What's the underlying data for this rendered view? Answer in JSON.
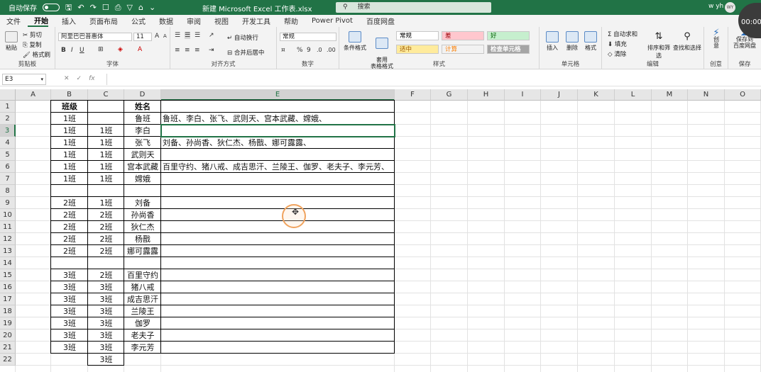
{
  "titlebar": {
    "autosave_label": "自动保存",
    "autosave_state": "关",
    "title": "新建 Microsoft Excel 工作表.xlsx",
    "search_placeholder": "搜索",
    "user_name": "w yh",
    "user_initials": "WY",
    "timer": "00:00"
  },
  "tabs": [
    "文件",
    "开始",
    "插入",
    "页面布局",
    "公式",
    "数据",
    "审阅",
    "视图",
    "开发工具",
    "帮助",
    "Power Pivot",
    "百度网盘"
  ],
  "active_tab": "开始",
  "ribbon": {
    "clipboard": {
      "label": "剪贴板",
      "paste": "粘贴",
      "cut": "剪切",
      "copy": "复制",
      "format_painter": "格式刷"
    },
    "font": {
      "label": "字体",
      "font_name": "阿里巴巴普惠体",
      "font_size": "11",
      "bold": "B",
      "italic": "I",
      "underline": "U"
    },
    "alignment": {
      "label": "对齐方式",
      "wrap": "自动换行",
      "merge": "合并后居中"
    },
    "number": {
      "label": "数字",
      "format": "常规",
      "percent": "%",
      "comma": "9"
    },
    "styles": {
      "label": "样式",
      "conditional": "条件格式",
      "table": "套用\n表格格式",
      "cells": [
        {
          "name": "常规",
          "bg": "#ffffff",
          "fg": "#000000"
        },
        {
          "name": "差",
          "bg": "#ffc7ce",
          "fg": "#9c0006"
        },
        {
          "name": "好",
          "bg": "#c6efce",
          "fg": "#006100"
        },
        {
          "name": "适中",
          "bg": "#ffeb9c",
          "fg": "#9c5700"
        },
        {
          "name": "计算",
          "bg": "#f2f2f2",
          "fg": "#fa7d00"
        },
        {
          "name": "检查单元格",
          "bg": "#a5a5a5",
          "fg": "#ffffff"
        }
      ]
    },
    "cells_group": {
      "label": "单元格",
      "insert": "插入",
      "delete": "删除",
      "format": "格式"
    },
    "editing": {
      "label": "编辑",
      "autosum": "自动求和",
      "fill": "填充",
      "clear": "清除",
      "sort": "排序和筛选",
      "find": "查找和选择"
    },
    "creativity": {
      "label": "创意",
      "create": "创\n意"
    },
    "save": {
      "label": "保存",
      "save_baidu": "保存到\n百度网盘"
    }
  },
  "formula_bar": {
    "name_box": "E3",
    "fx": "fx",
    "content": ""
  },
  "columns": [
    "A",
    "B",
    "C",
    "D",
    "E",
    "F",
    "G",
    "H",
    "I",
    "J",
    "K",
    "L",
    "M",
    "N",
    "O"
  ],
  "selected_column": "E",
  "rows": [
    "1",
    "2",
    "3",
    "4",
    "5",
    "6",
    "7",
    "8",
    "9",
    "10",
    "11",
    "12",
    "13",
    "14",
    "15",
    "16",
    "17",
    "18",
    "19",
    "20",
    "21",
    "22"
  ],
  "selected_row": "3",
  "sheet": {
    "col_b": [
      "班级",
      "1班",
      "1班",
      "1班",
      "1班",
      "1班",
      "1班",
      "",
      "2班",
      "2班",
      "2班",
      "2班",
      "2班",
      "",
      "3班",
      "3班",
      "3班",
      "3班",
      "3班",
      "3班",
      "3班",
      ""
    ],
    "col_c": [
      "",
      "",
      "1班",
      "1班",
      "1班",
      "1班",
      "1班",
      "",
      "1班",
      "2班",
      "2班",
      "2班",
      "2班",
      "",
      "2班",
      "3班",
      "3班",
      "3班",
      "3班",
      "3班",
      "3班",
      "3班"
    ],
    "col_d": [
      "姓名",
      "鲁班",
      "李白",
      "张飞",
      "武则天",
      "宫本武藏",
      "嫦娥",
      "",
      "刘备",
      "孙尚香",
      "狄仁杰",
      "杨戬",
      "娜可露露",
      "",
      "百里守约",
      "猪八戒",
      "成吉思汗",
      "兰陵王",
      "伽罗",
      "老夫子",
      "李元芳",
      ""
    ],
    "col_e": [
      "",
      "鲁班、李白、张飞、武则天、宫本武藏、嫦娥、",
      "",
      "刘备、孙尚香、狄仁杰、杨戬、娜可露露、",
      "",
      "百里守约、猪八戒、成吉思汗、兰陵王、伽罗、老夫子、李元芳、",
      "",
      "",
      "",
      "",
      "",
      "",
      "",
      "",
      "",
      "",
      "",
      "",
      "",
      "",
      "",
      ""
    ]
  }
}
